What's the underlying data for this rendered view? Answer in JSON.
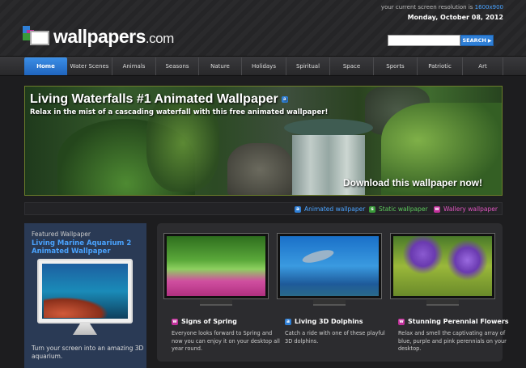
{
  "header": {
    "resolution_prefix": "your current screen resolution is",
    "resolution_value": "1600x900",
    "date": "Monday, October 08, 2012",
    "logo_main": "wallpapers",
    "logo_suffix": ".com",
    "search": {
      "value": "",
      "placeholder": "",
      "button_label": "SEARCH"
    }
  },
  "nav": {
    "items": [
      {
        "label": "Home",
        "active": true
      },
      {
        "label": "Water Scenes"
      },
      {
        "label": "Animals"
      },
      {
        "label": "Seasons"
      },
      {
        "label": "Nature"
      },
      {
        "label": "Holidays"
      },
      {
        "label": "Spiritual"
      },
      {
        "label": "Space"
      },
      {
        "label": "Sports"
      },
      {
        "label": "Patriotic"
      },
      {
        "label": "Art"
      }
    ]
  },
  "hero": {
    "title": "Living Waterfalls #1 Animated Wallpaper",
    "badge": "a",
    "subtitle": "Relax in the mist of a cascading waterfall with this free animated wallpaper!",
    "cta": "Download this wallpaper now!"
  },
  "legend": {
    "items": [
      {
        "badge": "a",
        "label": "Animated wallpaper",
        "color": "#2f7fd6",
        "text_color": "#4aa3ff"
      },
      {
        "badge": "s",
        "label": "Static wallpaper",
        "color": "#3a9a3a",
        "text_color": "#5cc95c"
      },
      {
        "badge": "w",
        "label": "Wallery wallpaper",
        "color": "#c0309a",
        "text_color": "#e055c0"
      }
    ]
  },
  "featured": {
    "label": "Featured Wallpaper",
    "title": "Living Marine Aquarium 2 Animated Wallpaper",
    "description": "Turn your screen into an amazing 3D aquarium."
  },
  "cards": [
    {
      "badge": "w",
      "badge_color": "#c0309a",
      "title": "Signs of Spring",
      "description": "Everyone looks forward to Spring and now you can enjoy it on your desktop all year round."
    },
    {
      "badge": "a",
      "badge_color": "#2f7fd6",
      "title": "Living 3D Dolphins",
      "description": "Catch a ride with one of these playful 3D dolphins."
    },
    {
      "badge": "w",
      "badge_color": "#c0309a",
      "title": "Stunning Perennial Flowers",
      "description": "Relax and smell the captivating array of blue, purple and pink perennials on your desktop."
    }
  ],
  "colors": {
    "accent": "#2f7fd6",
    "link": "#4aa3ff",
    "background": "#1d1d1f"
  }
}
